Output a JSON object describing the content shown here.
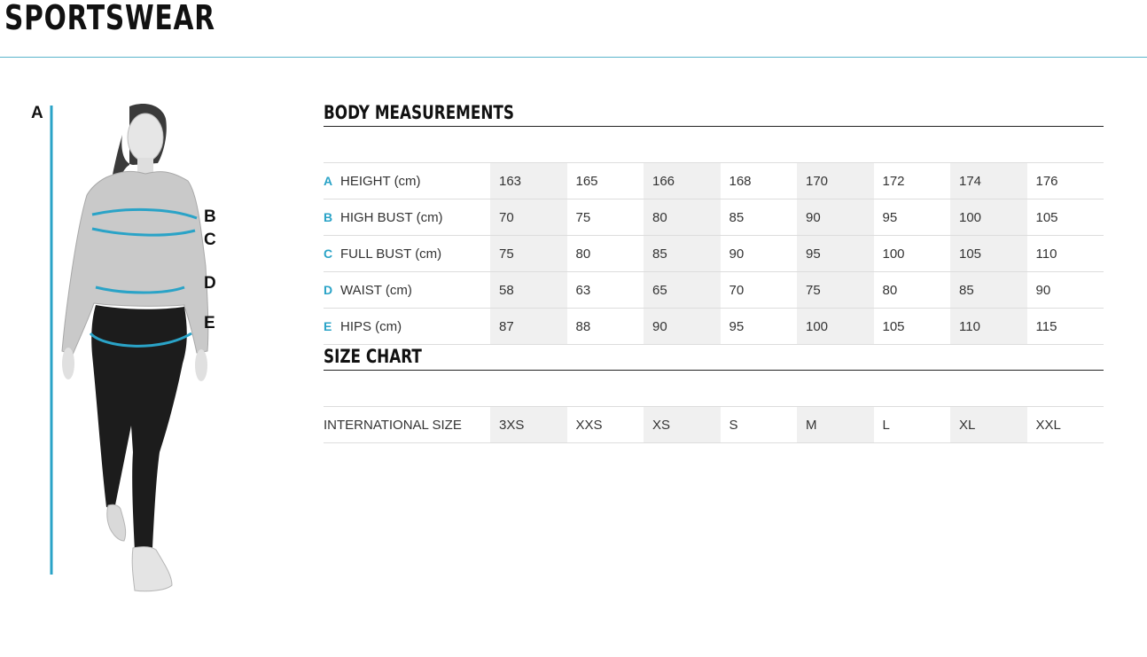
{
  "header": {
    "title": "SPORTSWEAR"
  },
  "figure": {
    "letters": [
      "A",
      "B",
      "C",
      "D",
      "E"
    ],
    "accent_color": "#2aa3c7"
  },
  "body_measurements": {
    "title": "BODY MEASUREMENTS",
    "rows": [
      {
        "letter": "A",
        "label": "HEIGHT (cm)",
        "values": [
          "163",
          "165",
          "166",
          "168",
          "170",
          "172",
          "174",
          "176"
        ]
      },
      {
        "letter": "B",
        "label": "HIGH BUST (cm)",
        "values": [
          "70",
          "75",
          "80",
          "85",
          "90",
          "95",
          "100",
          "105"
        ]
      },
      {
        "letter": "C",
        "label": "FULL BUST (cm)",
        "values": [
          "75",
          "80",
          "85",
          "90",
          "95",
          "100",
          "105",
          "110"
        ]
      },
      {
        "letter": "D",
        "label": "WAIST (cm)",
        "values": [
          "58",
          "63",
          "65",
          "70",
          "75",
          "80",
          "85",
          "90"
        ]
      },
      {
        "letter": "E",
        "label": "HIPS (cm)",
        "values": [
          "87",
          "88",
          "90",
          "95",
          "100",
          "105",
          "110",
          "115"
        ]
      }
    ]
  },
  "size_chart": {
    "title": "SIZE CHART",
    "rows": [
      {
        "label": "INTERNATIONAL SIZE",
        "values": [
          "3XS",
          "XXS",
          "XS",
          "S",
          "M",
          "L",
          "XL",
          "XXL"
        ]
      }
    ]
  }
}
